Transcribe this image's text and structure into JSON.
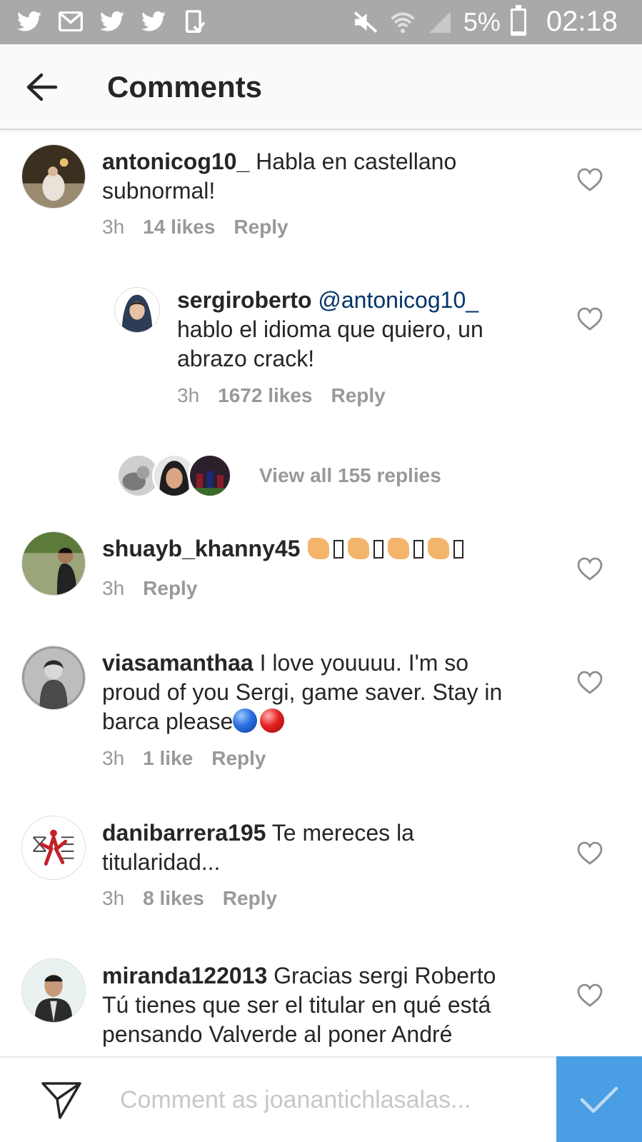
{
  "status_bar": {
    "left_icons": [
      "twitter-icon",
      "gmail-icon",
      "twitter-icon",
      "twitter-icon",
      "screenshot-icon"
    ],
    "right_icons": [
      "mute-icon",
      "wifi-icon",
      "signal-icon"
    ],
    "battery": "5%",
    "time": "02:18"
  },
  "header": {
    "title": "Comments"
  },
  "comments": [
    {
      "username": "antonicog10_",
      "text_line1": "Habla en castellano",
      "text_line2": "subnormal!",
      "time": "3h",
      "likes": "14 likes",
      "reply": "Reply"
    },
    {
      "username": "sergiroberto",
      "mention": "@antonicog10_",
      "text_line1": "hablo el idioma que quiero, un",
      "text_line2": "abrazo crack!",
      "time": "3h",
      "likes": "1672 likes",
      "reply": "Reply"
    },
    {
      "username": "shuayb_khanny45",
      "time": "3h",
      "reply": "Reply"
    },
    {
      "username": "viasamanthaa",
      "text_line1": "I love youuuu. I'm so",
      "text_line2": "proud of you Sergi, game saver. Stay in",
      "text_line3": "barca please",
      "time": "3h",
      "likes": "1 like",
      "reply": "Reply"
    },
    {
      "username": "danibarrera195",
      "text_line1": "Te mereces la",
      "text_line2": "titularidad...",
      "time": "3h",
      "likes": "8 likes",
      "reply": "Reply"
    },
    {
      "username": "miranda122013",
      "text_line1": "Gracias sergi Roberto",
      "text_line2": "Tú tienes que ser el titular en qué está",
      "text_line3": "pensando Valverde al poner André"
    }
  ],
  "view_replies": "View all 155 replies",
  "composer": {
    "placeholder": "Comment as joanantichlasalas..."
  },
  "colors": {
    "status_bar": "#a9a9a9",
    "mention": "#003569",
    "meta_text": "#999999",
    "post_button": "#4a9ee3"
  }
}
